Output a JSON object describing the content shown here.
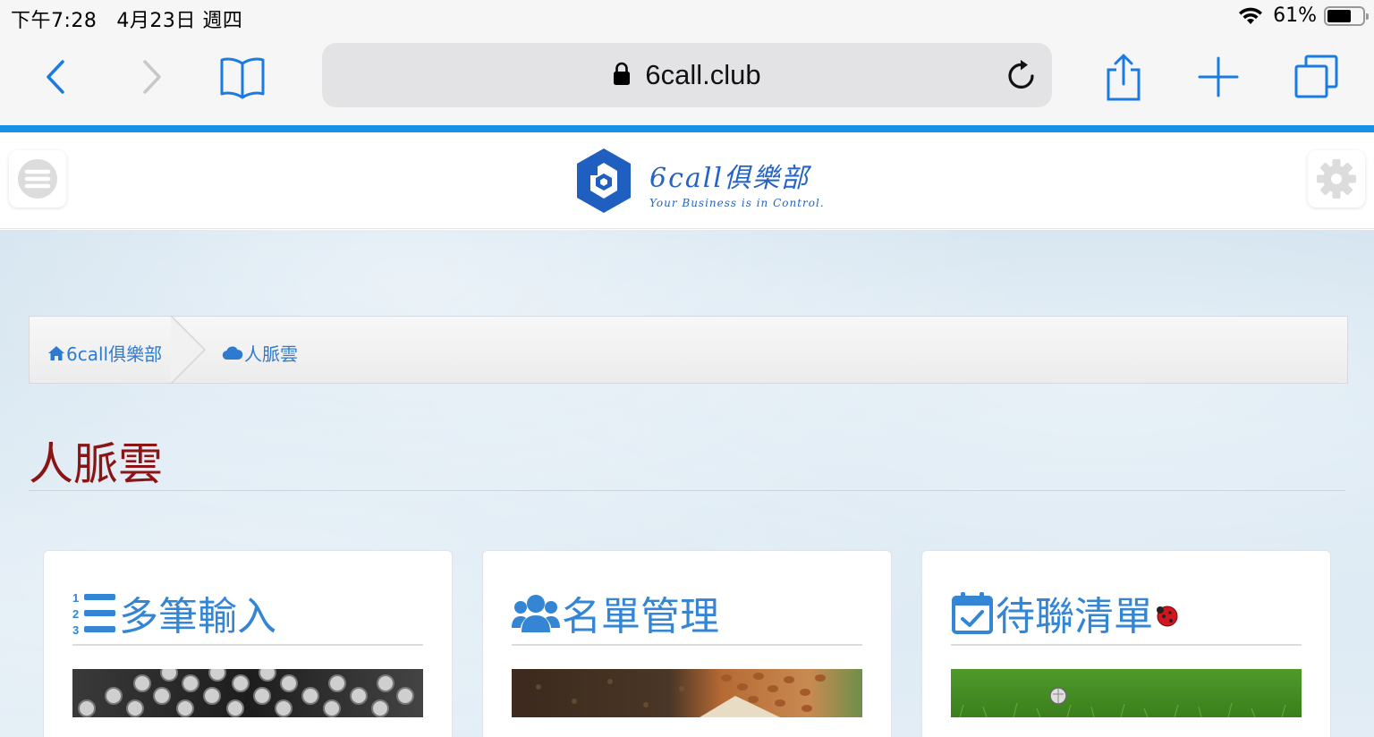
{
  "status_bar": {
    "time": "下午7:28",
    "date": "4月23日 週四",
    "battery_percent": "61%",
    "battery_level": 0.61
  },
  "browser": {
    "url": "6call.club",
    "icons": [
      "back-icon",
      "forward-icon",
      "bookmarks-icon",
      "lock-icon",
      "reload-icon",
      "share-icon",
      "new-tab-icon",
      "tabs-icon"
    ]
  },
  "site": {
    "logo_title": "6call俱樂部",
    "logo_subtitle": "Your Business is in Control.",
    "colors": {
      "brand_blue": "#1e5fc0",
      "link_blue": "#2f7ad1",
      "title_red": "#8b1515"
    }
  },
  "breadcrumb": {
    "items": [
      {
        "label": "6call俱樂部",
        "icon": "home-icon"
      },
      {
        "label": "人脈雲",
        "icon": "cloud-icon"
      }
    ]
  },
  "page": {
    "title": "人脈雲"
  },
  "cards": [
    {
      "label": "多筆輸入",
      "icon": "numbered-list-icon",
      "image": "typewriter-keys"
    },
    {
      "label": "名單管理",
      "icon": "users-icon",
      "image": "seeds-soil"
    },
    {
      "label": "待聯清單",
      "icon": "calendar-check-icon",
      "badge_icon": "ladybug-icon",
      "image": "grass-field"
    }
  ]
}
